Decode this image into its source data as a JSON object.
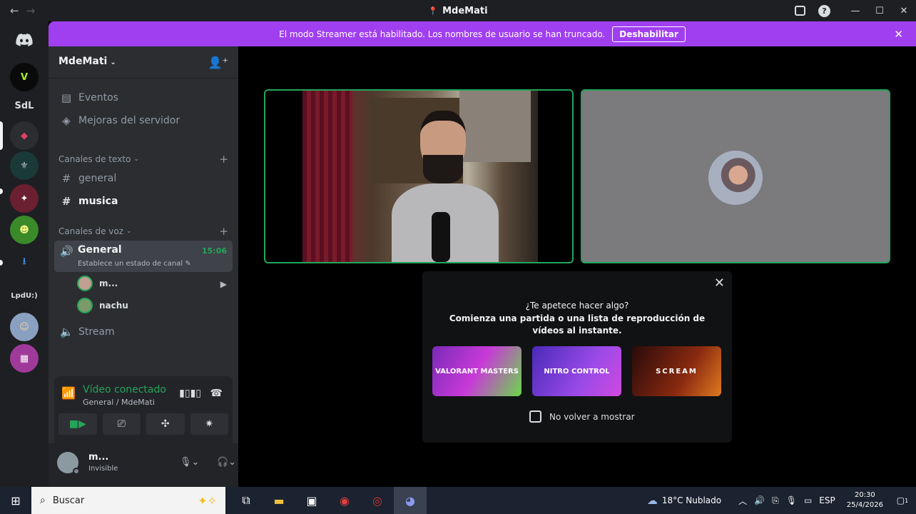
{
  "window": {
    "title": "MdeMati",
    "back": "←",
    "forward": "→",
    "minimize": "—",
    "maximize": "☐",
    "close": "✕"
  },
  "banner": {
    "text": "El modo Streamer está habilitado. Los nombres de usuario se han truncado.",
    "button": "Deshabilitar"
  },
  "rail": {
    "servers": [
      {
        "label": "V",
        "color": "#0a0a0a",
        "fg": "#a8f020"
      },
      {
        "label": "SdL",
        "color": "#1e1f22",
        "fg": "#dbdee1"
      },
      {
        "label": "◆",
        "color": "#2b2d31",
        "fg": "#e04060"
      },
      {
        "label": "⚜",
        "color": "#1a3a3a",
        "fg": "#c0c0c0"
      },
      {
        "label": "✦",
        "color": "#6a2030",
        "fg": "#ffffff"
      },
      {
        "label": "☻",
        "color": "#3a8a2a",
        "fg": "#f0f080"
      },
      {
        "label": "⭳",
        "color": "#1e1f22",
        "fg": "#3a8ae8"
      },
      {
        "label": "LpdU:)",
        "color": "#1e1f22",
        "fg": "#dbdee1"
      },
      {
        "label": "☺",
        "color": "#8aa0c0",
        "fg": "#f0d0a0"
      },
      {
        "label": "▦",
        "color": "#a03a9a",
        "fg": "#ffffff"
      }
    ]
  },
  "sidebar": {
    "server_name": "MdeMati",
    "events": "Eventos",
    "boosts": "Mejoras del servidor",
    "text_category": "Canales de texto",
    "text_channels": [
      "general",
      "musica"
    ],
    "voice_category": "Canales de voz",
    "voice_channel": {
      "name": "General",
      "time": "15:06",
      "status": "Establece un estado de canal"
    },
    "voice_users": [
      "m...",
      "nachu"
    ],
    "stream_channel": "Stream"
  },
  "voice_panel": {
    "title": "Vídeo conectado",
    "subtitle": "General / MdeMati"
  },
  "user": {
    "name": "m...",
    "status": "Invisible"
  },
  "popup": {
    "question": "¿Te apetece hacer algo?",
    "subtitle": "Comienza una partida o una lista de reproducción de vídeos al instante.",
    "cards": [
      "VALORANT MASTERS",
      "NITRO CONTROL",
      "SCREAM"
    ],
    "checkbox": "No volver a mostrar"
  },
  "taskbar": {
    "search_placeholder": "Buscar",
    "weather": "18°C  Nublado",
    "lang": "ESP",
    "time": "20:30",
    "date": "25/4/2026",
    "notifications": "1"
  }
}
